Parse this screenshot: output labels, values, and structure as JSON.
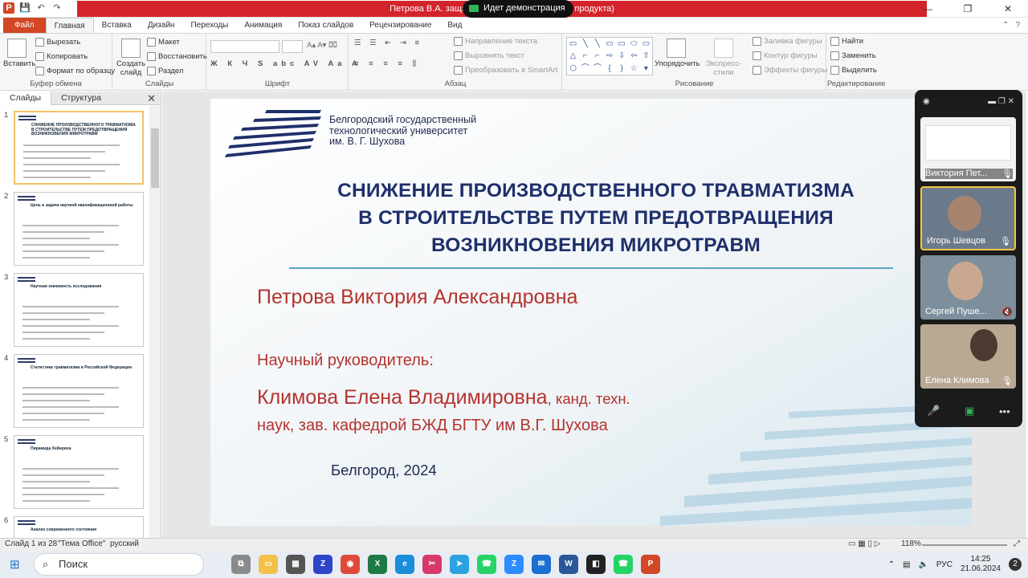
{
  "window": {
    "title": "Петрова В.А. защита ито… (Сбой активации продукта)",
    "demo_label": "Идет демонстрация",
    "controls": [
      "—",
      "❐",
      "✕"
    ]
  },
  "ribbon_tabs": [
    "Файл",
    "Главная",
    "Вставка",
    "Дизайн",
    "Переходы",
    "Анимация",
    "Показ слайдов",
    "Рецензирование",
    "Вид"
  ],
  "ribbon": {
    "clipboard": {
      "paste": "Вставить",
      "cut": "Вырезать",
      "copy": "Копировать",
      "format": "Формат по образцу",
      "label": "Буфер обмена"
    },
    "slides": {
      "new": "Создать слайд",
      "layout": "Макет",
      "reset": "Восстановить",
      "section": "Раздел",
      "label": "Слайды"
    },
    "font": {
      "label": "Шрифт",
      "size": "",
      "name": ""
    },
    "paragraph": {
      "direction": "Направление текста",
      "align": "Выровнять текст",
      "smartart": "Преобразовать в SmartArt",
      "label": "Абзац"
    },
    "drawing": {
      "arrange": "Упорядочить",
      "styles": "Экспресс-стили",
      "fill": "Заливка фигуры",
      "outline": "Контур фигуры",
      "effects": "Эффекты фигуры",
      "label": "Рисование",
      "shapes": [
        "▭",
        "╲",
        "╲",
        "▭",
        "▭",
        "⬭",
        "▭",
        "△",
        "⌐",
        "⌐",
        "⇨",
        "⇩",
        "⇦",
        "⇧",
        "⬡",
        "⌒",
        "⌒",
        "{",
        "}",
        "☆",
        "▾"
      ]
    },
    "editing": {
      "find": "Найти",
      "replace": "Заменить",
      "select": "Выделить",
      "label": "Редактирование"
    }
  },
  "left_pane": {
    "tabs": [
      "Слайды",
      "Структура"
    ],
    "close": "✕",
    "slide_numbers": [
      "1",
      "2",
      "3",
      "4",
      "5",
      "6"
    ],
    "thumb_titles": [
      "СНИЖЕНИЕ ПРОИЗВОДСТВЕННОГО ТРАВМАТИЗМА В СТРОИТЕЛЬСТВЕ ПУТЕМ ПРЕДОТВРАЩЕНИЯ ВОЗНИКНОВЕНИЯ МИКРОТРАВМ",
      "Цель и задачи научной квалификационной работы",
      "Научная значимость исследования",
      "Статистика травматизма в Российской Федерации",
      "Пирамида Хейнриха",
      "Анализ современного состояния"
    ]
  },
  "slide": {
    "university": [
      "Белгородский государственный",
      "технологический университет",
      "им. В. Г. Шухова"
    ],
    "title": [
      "СНИЖЕНИЕ ПРОИЗВОДСТВЕННОГО ТРАВМАТИЗМА",
      "В СТРОИТЕЛЬСТВЕ ПУТЕМ ПРЕДОТВРАЩЕНИЯ",
      "ВОЗНИКНОВЕНИЯ МИКРОТРАВМ"
    ],
    "author": "Петрова Виктория Александровна",
    "supervisor_label": "Научный руководитель:",
    "supervisor_name": "Климова Елена Владимировна",
    "supervisor_degree": ", канд. техн.",
    "supervisor_line2": "наук, зав. кафедрой БЖД БГТУ им В.Г. Шухова",
    "city_year": "Белгород, 2024"
  },
  "meeting": {
    "participants": [
      {
        "name": "Виктория Пет...",
        "mic": "on"
      },
      {
        "name": "Игорь Шевцов",
        "mic": "on",
        "active": true
      },
      {
        "name": "Сергей Пуше...",
        "mic": "off"
      },
      {
        "name": "Елена Климова",
        "mic": "on"
      }
    ],
    "controls": [
      "mic-icon",
      "share-icon",
      "more-icon"
    ]
  },
  "status_bar": {
    "slide": "Слайд 1 из 28",
    "theme": "\"Тема Office\"",
    "language": "русский",
    "zoom": "118%"
  },
  "taskbar": {
    "search_placeholder": "Поиск",
    "time": "14:25",
    "date": "21.06.2024",
    "lang": "РУС",
    "notifications": "2"
  }
}
